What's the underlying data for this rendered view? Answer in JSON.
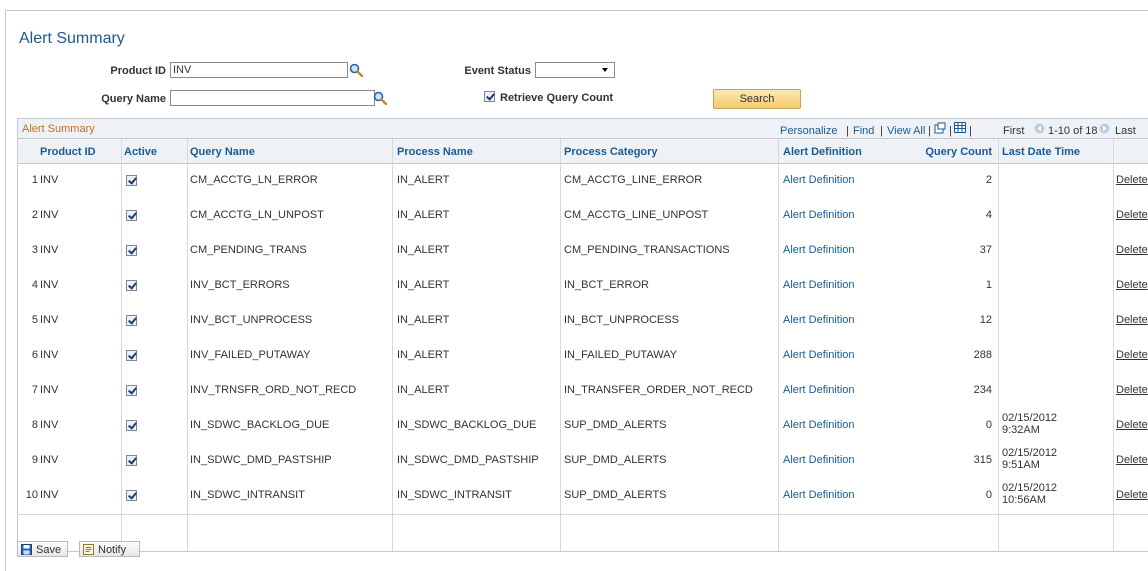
{
  "page": {
    "title": "Alert Summary"
  },
  "form": {
    "product_id_label": "Product ID",
    "product_id_value": "INV",
    "query_name_label": "Query Name",
    "query_name_value": "",
    "event_status_label": "Event Status",
    "event_status_value": "",
    "retrieve_query_count_label": "Retrieve Query Count",
    "retrieve_query_count_checked": true,
    "search_label": "Search"
  },
  "grid": {
    "title": "Alert Summary",
    "personalize": "Personalize",
    "find": "Find",
    "view_all": "View All",
    "first": "First",
    "range": "1-10 of 18",
    "last": "Last",
    "columns": [
      "Product ID",
      "Active",
      "Query Name",
      "Process Name",
      "Process Category",
      "Alert Definition",
      "Query Count",
      "Last Date Time"
    ],
    "rows": [
      {
        "num": "1",
        "product": "INV",
        "query": "CM_ACCTG_LN_ERROR",
        "process": "IN_ALERT",
        "category": "CM_ACCTG_LINE_ERROR",
        "alert": "Alert Definition",
        "count": "2",
        "date": "",
        "time": "",
        "delete": "Delete"
      },
      {
        "num": "2",
        "product": "INV",
        "query": "CM_ACCTG_LN_UNPOST",
        "process": "IN_ALERT",
        "category": "CM_ACCTG_LINE_UNPOST",
        "alert": "Alert Definition",
        "count": "4",
        "date": "",
        "time": "",
        "delete": "Delete"
      },
      {
        "num": "3",
        "product": "INV",
        "query": "CM_PENDING_TRANS",
        "process": "IN_ALERT",
        "category": "CM_PENDING_TRANSACTIONS",
        "alert": "Alert Definition",
        "count": "37",
        "date": "",
        "time": "",
        "delete": "Delete"
      },
      {
        "num": "4",
        "product": "INV",
        "query": "INV_BCT_ERRORS",
        "process": "IN_ALERT",
        "category": "IN_BCT_ERROR",
        "alert": "Alert Definition",
        "count": "1",
        "date": "",
        "time": "",
        "delete": "Delete"
      },
      {
        "num": "5",
        "product": "INV",
        "query": "INV_BCT_UNPROCESS",
        "process": "IN_ALERT",
        "category": "IN_BCT_UNPROCESS",
        "alert": "Alert Definition",
        "count": "12",
        "date": "",
        "time": "",
        "delete": "Delete"
      },
      {
        "num": "6",
        "product": "INV",
        "query": "INV_FAILED_PUTAWAY",
        "process": "IN_ALERT",
        "category": "IN_FAILED_PUTAWAY",
        "alert": "Alert Definition",
        "count": "288",
        "date": "",
        "time": "",
        "delete": "Delete"
      },
      {
        "num": "7",
        "product": "INV",
        "query": "INV_TRNSFR_ORD_NOT_RECD",
        "process": "IN_ALERT",
        "category": "IN_TRANSFER_ORDER_NOT_RECD",
        "alert": "Alert Definition",
        "count": "234",
        "date": "",
        "time": "",
        "delete": "Delete"
      },
      {
        "num": "8",
        "product": "INV",
        "query": "IN_SDWC_BACKLOG_DUE",
        "process": "IN_SDWC_BACKLOG_DUE",
        "category": "SUP_DMD_ALERTS",
        "alert": "Alert Definition",
        "count": "0",
        "date": "02/15/2012",
        "time": "9:32AM",
        "delete": "Delete"
      },
      {
        "num": "9",
        "product": "INV",
        "query": "IN_SDWC_DMD_PASTSHIP",
        "process": "IN_SDWC_DMD_PASTSHIP",
        "category": "SUP_DMD_ALERTS",
        "alert": "Alert Definition",
        "count": "315",
        "date": "02/15/2012",
        "time": "9:51AM",
        "delete": "Delete"
      },
      {
        "num": "10",
        "product": "INV",
        "query": "IN_SDWC_INTRANSIT",
        "process": "IN_SDWC_INTRANSIT",
        "category": "SUP_DMD_ALERTS",
        "alert": "Alert Definition",
        "count": "0",
        "date": "02/15/2012",
        "time": "10:56AM",
        "delete": "Delete"
      }
    ]
  },
  "footer": {
    "save_label": "Save",
    "notify_label": "Notify"
  },
  "colors": {
    "link": "#1b5a92",
    "grid_title": "#c0701a",
    "header_bg": "#eef2f6",
    "button": "#f6c96a"
  }
}
